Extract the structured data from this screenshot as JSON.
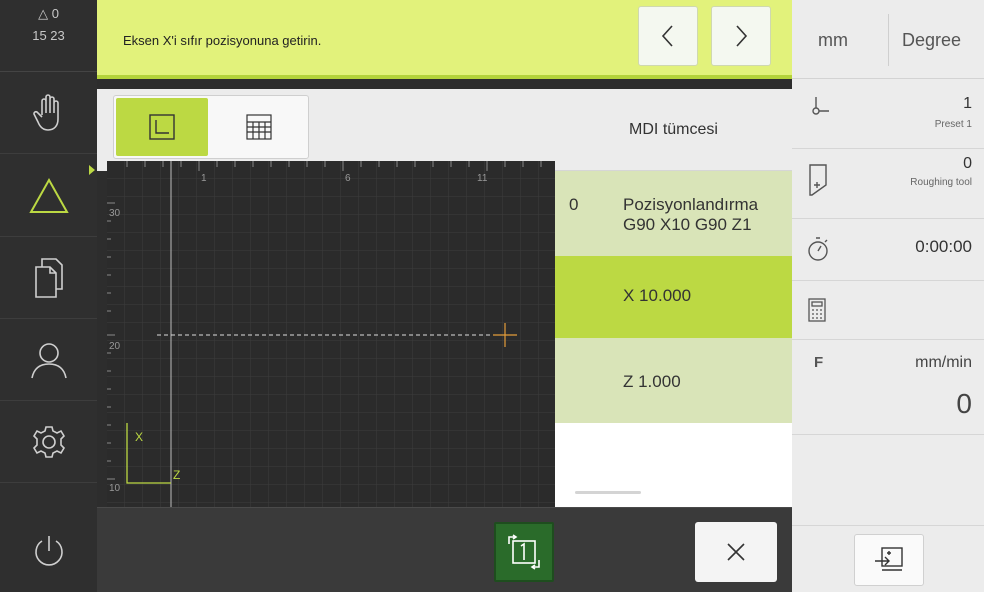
{
  "status": {
    "line1": "△ 0",
    "line2": "15 23"
  },
  "nav": {
    "items": [
      {
        "name": "manual-mode",
        "icon": "hand-icon"
      },
      {
        "name": "mdi-mode",
        "icon": "triangle-icon",
        "active": true
      },
      {
        "name": "file-management",
        "icon": "files-icon"
      },
      {
        "name": "user-login",
        "icon": "user-icon"
      },
      {
        "name": "settings",
        "icon": "gear-icon"
      },
      {
        "name": "power",
        "icon": "power-icon"
      }
    ]
  },
  "message": {
    "text": "Eksen X'i sıfır pozisyonuna getirin."
  },
  "graph": {
    "top_ticks": [
      "1",
      "6",
      "11"
    ],
    "left_ticks": [
      "30",
      "20",
      "10"
    ],
    "axis_x": "X",
    "axis_z": "Z"
  },
  "mdi": {
    "header": "MDI tümcesi",
    "rows": [
      {
        "index": "0",
        "line1": "Pozisyonlandırma",
        "line2": "G90 X10 G90 Z1"
      },
      {
        "text": "X 10.000"
      },
      {
        "text": "Z 1.000"
      }
    ]
  },
  "units": {
    "length": "mm",
    "angle": "Degree"
  },
  "right": {
    "preset_value": "1",
    "preset_label": "Preset 1",
    "tool_value": "0",
    "tool_label": "Roughing tool",
    "timer_value": "0:00:00",
    "feed_label": "F",
    "feed_unit": "mm/min",
    "feed_value": "0"
  },
  "colors": {
    "accent": "#bcd943",
    "message_bg": "#e2f27b",
    "row_bg": "#d9e4b8"
  }
}
